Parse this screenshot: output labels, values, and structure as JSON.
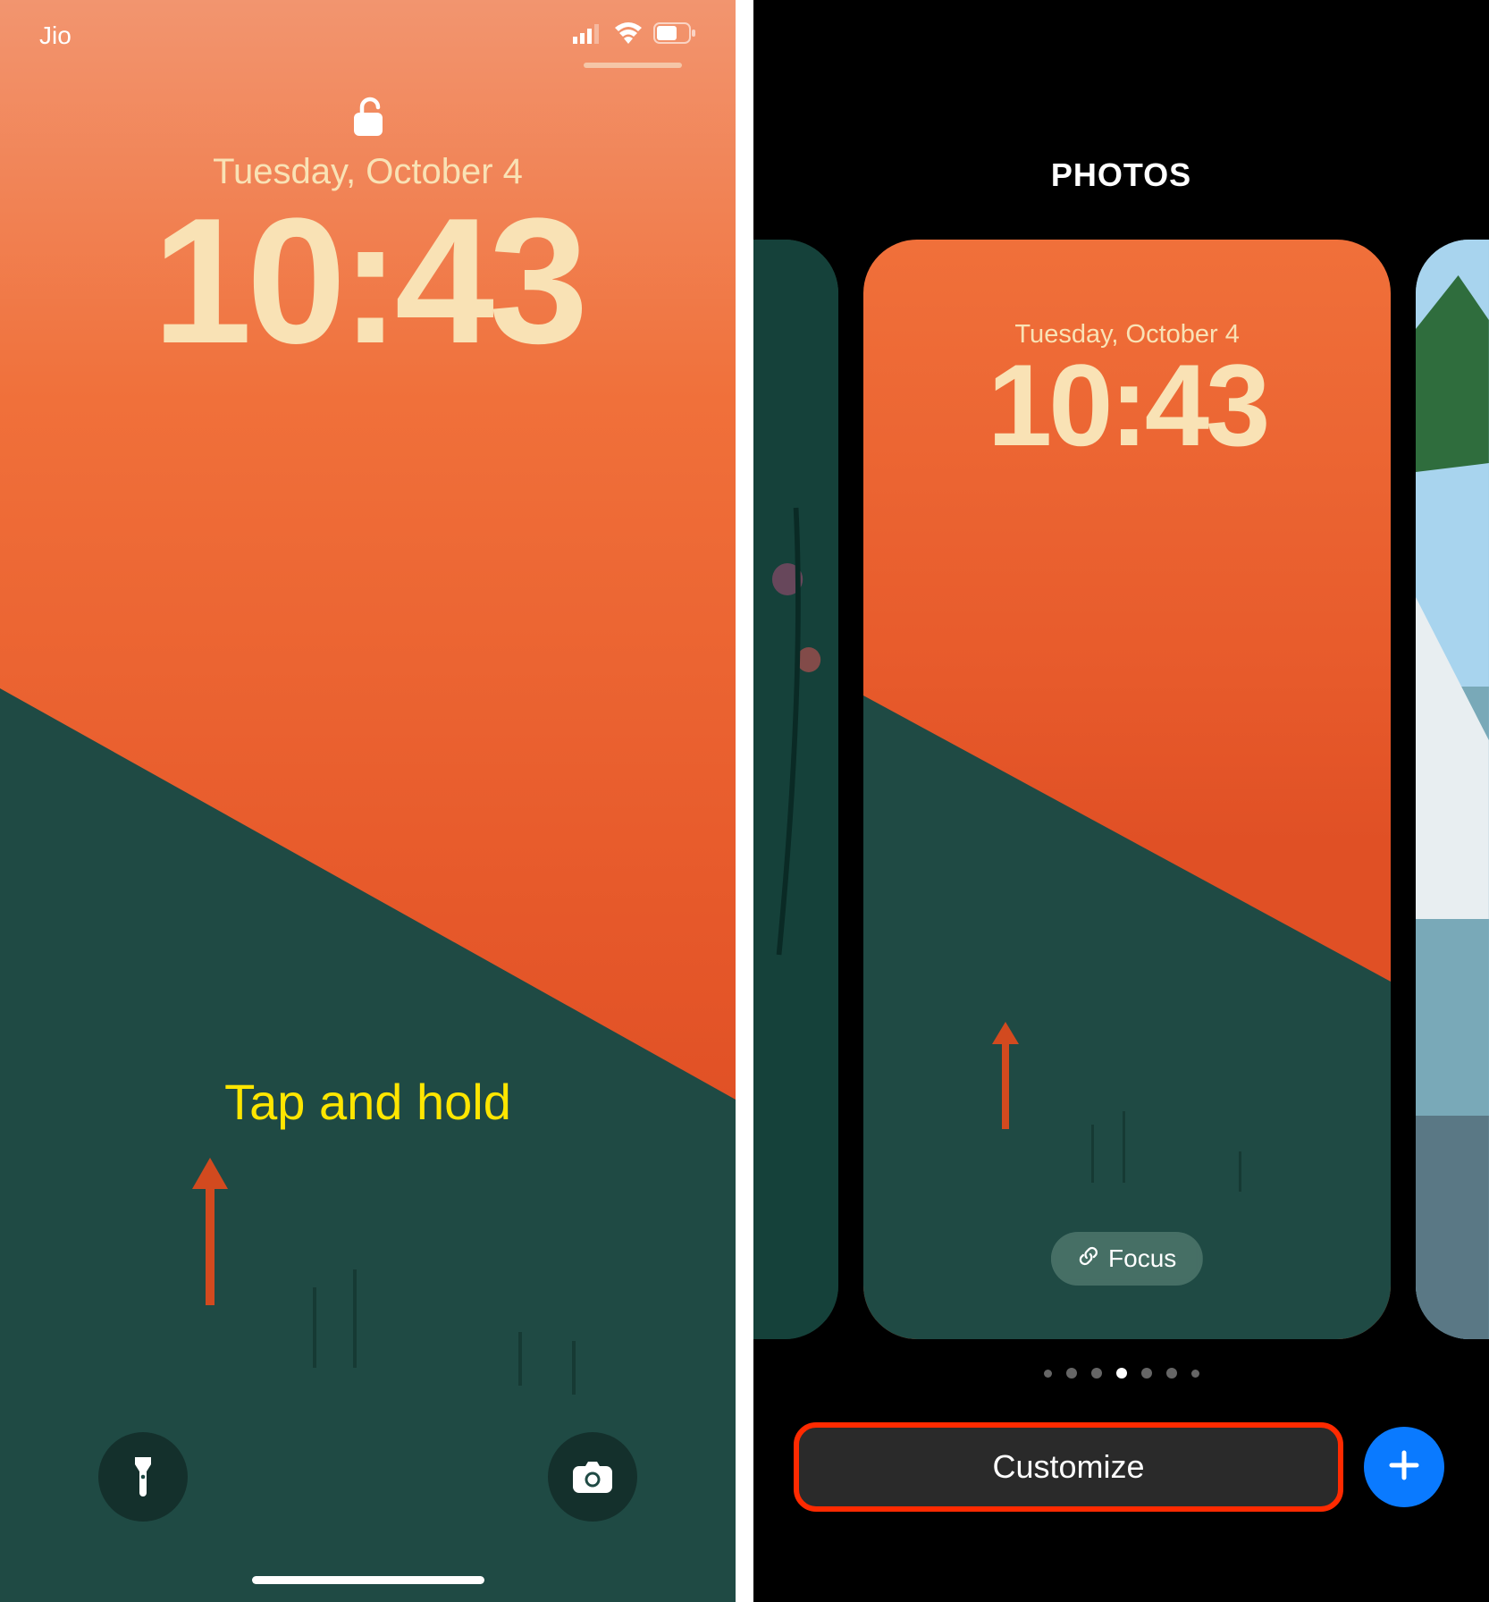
{
  "left_screen": {
    "carrier": "Jio",
    "date": "Tuesday, October 4",
    "time": "10:43",
    "hint": "Tap and hold"
  },
  "right_screen": {
    "title": "PHOTOS",
    "card": {
      "date": "Tuesday, October 4",
      "time": "10:43",
      "focus_label": "Focus"
    },
    "customize_label": "Customize",
    "pager": {
      "count": 7,
      "active_index": 3
    }
  }
}
